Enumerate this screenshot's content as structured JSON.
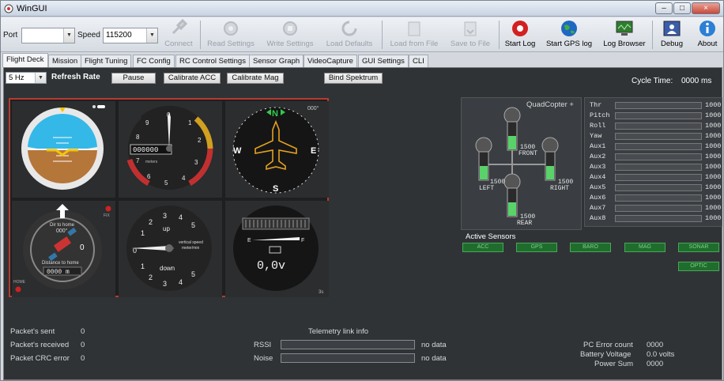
{
  "window": {
    "title": "WinGUI",
    "controls": {
      "minimize": "–",
      "maximize": "□",
      "close": "×"
    }
  },
  "toolbar": {
    "port_label": "Port",
    "port_value": "",
    "speed_label": "Speed",
    "speed_value": "115200",
    "buttons": [
      {
        "label": "Connect",
        "icon": "connect-icon",
        "enabled": false
      },
      {
        "label": "Read Settings",
        "icon": "read-settings-icon",
        "enabled": false
      },
      {
        "label": "Write Settings",
        "icon": "write-settings-icon",
        "enabled": false
      },
      {
        "label": "Load Defaults",
        "icon": "load-defaults-icon",
        "enabled": false
      },
      {
        "label": "Load from File",
        "icon": "load-file-icon",
        "enabled": false
      },
      {
        "label": "Save to File",
        "icon": "save-file-icon",
        "enabled": false
      },
      {
        "label": "Start Log",
        "icon": "record-icon",
        "enabled": true
      },
      {
        "label": "Start GPS log",
        "icon": "globe-icon",
        "enabled": true
      },
      {
        "label": "Log Browser",
        "icon": "log-browser-icon",
        "enabled": true
      },
      {
        "label": "Debug",
        "icon": "debug-icon",
        "enabled": true
      },
      {
        "label": "About",
        "icon": "info-icon",
        "enabled": true
      }
    ]
  },
  "tabs": [
    "Flight Deck",
    "Mission",
    "Flight Tuning",
    "FC Config",
    "RC Control Settings",
    "Sensor Graph",
    "VideoCapture",
    "GUI Settings",
    "CLI"
  ],
  "controls": {
    "rate_value": "5 Hz",
    "refresh_label": "Refresh Rate",
    "pause_label": "Pause",
    "calibrate_acc_label": "Calibrate ACC",
    "calibrate_mag_label": "Calibrate Mag",
    "bind_label": "Bind Spektrum",
    "cycle_time_label": "Cycle Time:",
    "cycle_time_value": "0000 ms"
  },
  "gauges": {
    "altimeter_value": "000000",
    "altimeter_unit": "meters",
    "altimeter_ticks": [
      "0",
      "1",
      "2",
      "3",
      "4",
      "5",
      "6",
      "7",
      "8",
      "9"
    ],
    "heading_deg": "000°",
    "heading_letters": [
      "N",
      "E",
      "S",
      "W"
    ],
    "home_dir_label": "Dir to home",
    "home_dir_value": "000°",
    "home_dist_label": "Distance to home",
    "home_dist_value": "0000 m",
    "home_label": "HOME",
    "fix_label": "FIX",
    "vario_up": "up",
    "vario_down": "down",
    "vario_label": "vertical speed",
    "vario_unit": "meter/min",
    "vario_numbers": [
      "1",
      "2",
      "3",
      "4",
      "5",
      "0"
    ],
    "battery_empty": "E",
    "battery_full": "F",
    "battery_value": "0,0v",
    "battery_cells": "3s"
  },
  "quad": {
    "title": "QuadCopter +",
    "front_value": "1500",
    "front_label": "FRONT",
    "left_value": "1500",
    "left_label": "LEFT",
    "right_value": "1500",
    "right_label": "RIGHT",
    "rear_value": "1500",
    "rear_label": "REAR",
    "motor_level": 0.5
  },
  "rc_channels": [
    {
      "name": "Thr",
      "value": "1000"
    },
    {
      "name": "Pitch",
      "value": "1000"
    },
    {
      "name": "Roll",
      "value": "1000"
    },
    {
      "name": "Yaw",
      "value": "1000"
    },
    {
      "name": "Aux1",
      "value": "1000"
    },
    {
      "name": "Aux2",
      "value": "1000"
    },
    {
      "name": "Aux3",
      "value": "1000"
    },
    {
      "name": "Aux4",
      "value": "1000"
    },
    {
      "name": "Aux5",
      "value": "1000"
    },
    {
      "name": "Aux6",
      "value": "1000"
    },
    {
      "name": "Aux7",
      "value": "1000"
    },
    {
      "name": "Aux8",
      "value": "1000"
    }
  ],
  "sensors": {
    "title": "Active Sensors",
    "items": [
      "ACC",
      "GPS",
      "BARO",
      "MAG",
      "SONAR",
      "OPTIC"
    ]
  },
  "packets": {
    "sent_label": "Packet's sent",
    "sent_value": "0",
    "received_label": "Packet's received",
    "received_value": "0",
    "crc_label": "Packet CRC error",
    "crc_value": "0"
  },
  "telemetry": {
    "title": "Telemetry link info",
    "rssi_label": "RSSI",
    "rssi_value": "no data",
    "noise_label": "Noise",
    "noise_value": "no data"
  },
  "status": {
    "pc_error_label": "PC Error count",
    "pc_error_value": "0000",
    "battery_label": "Battery Voltage",
    "battery_value": "0.0 volts",
    "power_label": "Power Sum",
    "power_value": "0000"
  },
  "colors": {
    "sky": "#34b8e8",
    "ground": "#b5763a",
    "motor_green": "#59d26a",
    "panel_border": "#b83a2e"
  }
}
